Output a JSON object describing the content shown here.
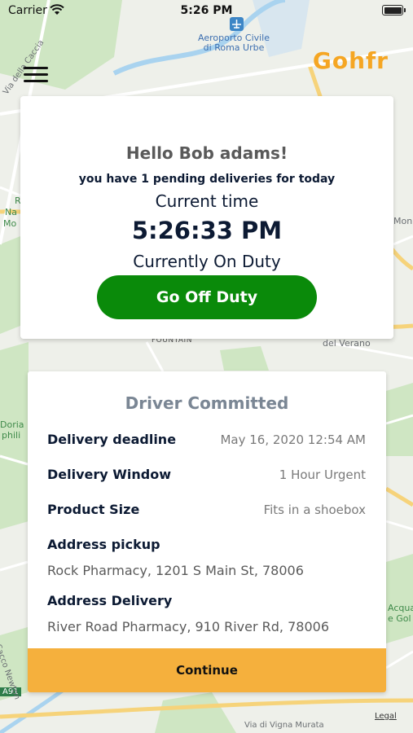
{
  "status_bar": {
    "carrier": "Carrier",
    "time": "5:26 PM",
    "icons": [
      "wifi-icon",
      "battery-icon"
    ]
  },
  "map": {
    "labels": {
      "airport": "Aeroporto Civile\ndi Roma Urbe",
      "via_della_caccia": "Via della Caccia",
      "fountain": "FOUNTAIN",
      "del_verano": "del Verano",
      "via_di_vigna_murata": "Via di Vigna Murata",
      "legal": "Legal",
      "a91": "A91",
      "r_label": "R",
      "na_label": "Na",
      "mo_label": "Mo",
      "mon_label": "Mon",
      "doria": "Doria",
      "phili": "phili",
      "acqua": "Acqua",
      "gol": "e Gol",
      "sacco": "Sacco Newton"
    }
  },
  "header": {
    "brand": "Gohfr",
    "brand_color": "#f5a623"
  },
  "greeting": {
    "title": "Hello Bob adams!",
    "pending": "you have 1 pending deliveries for today",
    "current_time_label": "Current time",
    "current_time_value": "5:26:33 PM",
    "duty_status": "Currently On Duty",
    "duty_button": "Go Off Duty",
    "duty_button_color": "#0a8a0a"
  },
  "delivery": {
    "title": "Driver Committed",
    "rows": [
      {
        "label": "Delivery deadline",
        "value": "May 16, 2020  12:54 AM"
      },
      {
        "label": "Delivery Window",
        "value": "1 Hour Urgent"
      },
      {
        "label": "Product Size",
        "value": "Fits in a shoebox"
      }
    ],
    "address_pickup_label": "Address pickup",
    "address_pickup_value": "Rock Pharmacy, 1201 S Main St, 78006",
    "address_delivery_label": "Address Delivery",
    "address_delivery_value": "River Road Pharmacy, 910 River Rd, 78006",
    "continue_button": "Continue",
    "continue_color": "#f5b03d"
  }
}
